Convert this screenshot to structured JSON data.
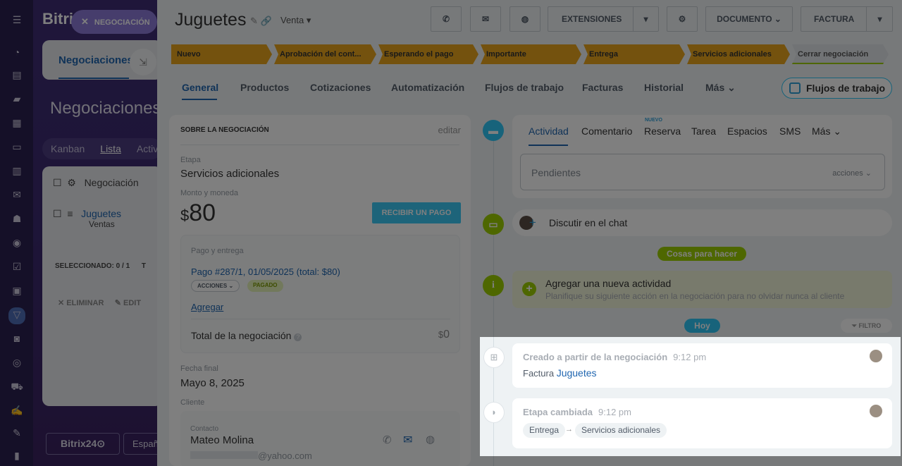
{
  "background": {
    "logo": "Bitri",
    "pill_label": "NEGOCIACIÓN",
    "tab_negociaciones": "Negociaciones",
    "page_title": "Negociaciones",
    "views": [
      "Kanban",
      "Lista",
      "Activ"
    ],
    "table_header": "Negociación",
    "row_title": "Juguetes",
    "row_sub": "Ventas",
    "selected": "SELECCIONADO: 0 / 1",
    "selected_extra": "T",
    "delete": "ELIMINAR",
    "edit": "EDIT",
    "footer_logo": "Bitrix24",
    "footer_lang": "Españ"
  },
  "deal": {
    "title": "Juguetes",
    "type": "Venta",
    "buttons": {
      "extensions": "EXTENSIONES",
      "document": "DOCUMENTO",
      "invoice": "FACTURA"
    },
    "stages": [
      "Nuevo",
      "Aprobación del cont...",
      "Esperando el pago",
      "Importante",
      "Entrega",
      "Servicios adicionales",
      "Cerrar negociación"
    ],
    "tabs": [
      "General",
      "Productos",
      "Cotizaciones",
      "Automatización",
      "Flujos de trabajo",
      "Facturas",
      "Historial",
      "Más"
    ],
    "workflows_btn": "Flujos de trabajo"
  },
  "about": {
    "title": "SOBRE LA NEGOCIACIÓN",
    "edit": "editar",
    "stage_label": "Etapa",
    "stage_value": "Servicios adicionales",
    "amount_label": "Monto y moneda",
    "currency": "$",
    "amount": "80",
    "receive_btn": "RECIBIR UN PAGO",
    "payment_label": "Pago y entrega",
    "payment_link": "Pago #287/1, 01/05/2025 (total: $80)",
    "actions_chip": "ACCIONES",
    "paid_chip": "PAGADO",
    "add_link": "Agregar",
    "total_label": "Total de la negociación",
    "total_currency": "$",
    "total_value": "0",
    "close_label": "Fecha final",
    "close_value": "Mayo 8, 2025",
    "client_label": "Cliente",
    "contact_label": "Contacto",
    "contact_name": "Mateo Molina",
    "contact_email": "@yahoo.com"
  },
  "activity": {
    "tabs": [
      "Actividad",
      "Comentario",
      "Reserva",
      "Tarea",
      "Espacios",
      "SMS",
      "Más"
    ],
    "new_badge": "NUEVO",
    "pending": "Pendientes",
    "actions": "acciones",
    "chat": "Discutir en el chat",
    "todo_badge": "Cosas para hacer",
    "add_title": "Agregar una nueva actividad",
    "add_sub": "Planifique su siguiente acción en la negociación para no olvidar nunca al cliente",
    "today": "Hoy",
    "filter": "FILTRO"
  },
  "history": [
    {
      "title": "Creado a partir de la negociación",
      "time": "9:12 pm",
      "label": "Factura",
      "link": "Juguetes"
    },
    {
      "title": "Etapa cambiada",
      "time": "9:12 pm",
      "from": "Entrega",
      "to": "Servicios adicionales"
    }
  ]
}
